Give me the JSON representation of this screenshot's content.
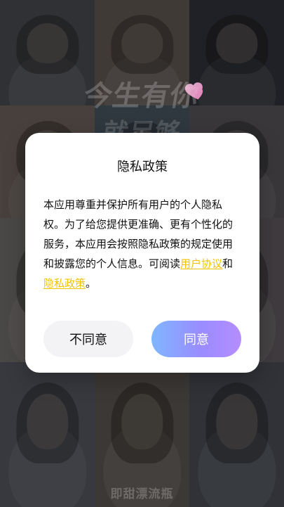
{
  "background": {
    "watermark_top": "今生有你",
    "watermark_top2": "就足够",
    "watermark_bottom": "即甜漂流瓶",
    "palette": [
      "#5d5f66",
      "#7c6f6a",
      "#3f4049",
      "#8a7b73",
      "#5a6b7a",
      "#6f6a70",
      "#8f8a86",
      "#4f5560",
      "#7a7277"
    ]
  },
  "modal": {
    "title": "隐私政策",
    "body": {
      "p1": "本应用尊重并保护所有用户的个人隐私权。为了给您提供更准确、更有个性化的服务，本应用会按照隐私政策的规定使用和披露您的个人信息。可阅读",
      "link1": "用户协议",
      "mid": "和",
      "link2": "隐私政策",
      "end": "。"
    },
    "buttons": {
      "disagree": "不同意",
      "agree": "同意"
    }
  }
}
